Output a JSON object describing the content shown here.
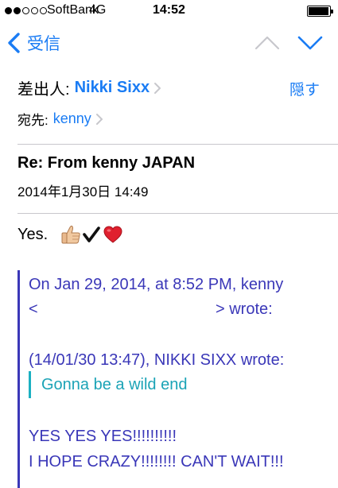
{
  "status_bar": {
    "carrier": "SoftBank",
    "network": "4G",
    "time": "14:52",
    "signal_bars": 2,
    "signal_max": 5,
    "battery_fraction": 0.95
  },
  "nav": {
    "back_label": "受信",
    "back_icon": "chevron-left-icon",
    "prev_icon": "chevron-up-icon",
    "next_icon": "chevron-down-icon",
    "prev_enabled": false,
    "next_enabled": true
  },
  "header": {
    "from_label": "差出人:",
    "from_name": "Nikki Sixx",
    "hide_label": "隠す",
    "to_label": "宛先:",
    "to_name": "kenny",
    "subject": "Re: From kenny JAPAN",
    "date": "2014年1月30日 14:49"
  },
  "body": {
    "greeting": "Yes.",
    "emojis": [
      "thumbs-up-icon",
      "check-mark-icon",
      "heart-icon"
    ],
    "quote": {
      "line1": "On Jan 29, 2014, at 8:52 PM, kenny",
      "line2_open": "<",
      "line2_close": "> wrote:",
      "attribution": "(14/01/30 13:47), NIKKI SIXX wrote:",
      "inner_quote": "Gonna be a wild end",
      "line_yes": "YES YES YES!!!!!!!!!!",
      "line_hope": "I HOPE CRAZY!!!!!!!! CAN'T WAIT!!!"
    }
  },
  "colors": {
    "accent": "#1a7cf4",
    "quote": "#3a37b8",
    "inner_quote": "#1ba3b6",
    "divider": "#c8c7cc"
  }
}
